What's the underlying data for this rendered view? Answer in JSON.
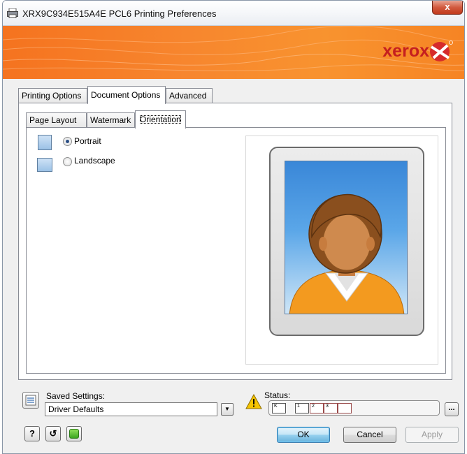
{
  "window": {
    "title": "XRX9C934E515A4E PCL6 Printing Preferences",
    "close_label": "x"
  },
  "banner": {
    "brand": "xerox",
    "brand_color": "#c51f1f",
    "background_color": "#f7862e"
  },
  "main_tabs": [
    {
      "label": "Printing Options",
      "active": false
    },
    {
      "label": "Document Options",
      "active": true
    },
    {
      "label": "Advanced",
      "active": false
    }
  ],
  "sub_tabs": [
    {
      "label": "Page Layout",
      "active": false
    },
    {
      "label": "Watermark",
      "active": false
    },
    {
      "label": "Orientation",
      "active": true
    }
  ],
  "orientation": {
    "options": [
      {
        "label": "Portrait",
        "selected": true,
        "icon": "portrait-page-icon"
      },
      {
        "label": "Landscape",
        "selected": false,
        "icon": "landscape-page-icon"
      }
    ]
  },
  "footer": {
    "saved_settings_label": "Saved Settings:",
    "saved_settings_value": "Driver Defaults",
    "status_label": "Status:",
    "status_trays": [
      "K",
      "1",
      "2",
      "3",
      ""
    ],
    "more_label": "...",
    "help_label": "?",
    "reset_label": "↺",
    "ok_label": "OK",
    "cancel_label": "Cancel",
    "apply_label": "Apply"
  }
}
